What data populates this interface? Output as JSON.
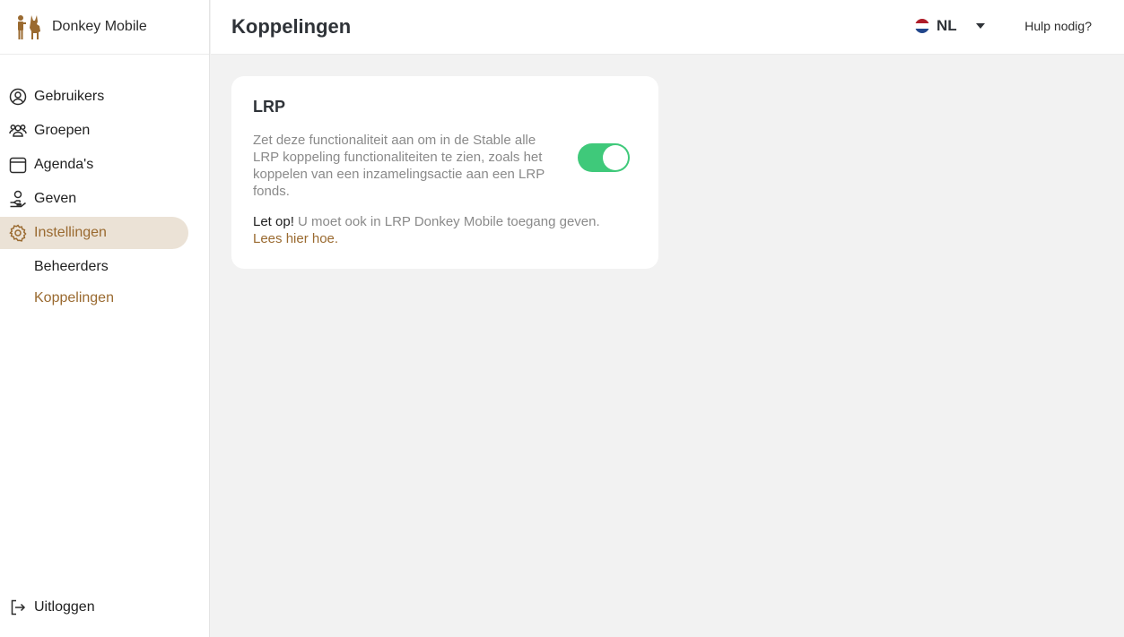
{
  "brand": {
    "name": "Donkey Mobile",
    "logo_icon": "donkey-logo-icon",
    "accent": "#9a6a30"
  },
  "sidebar": {
    "items": [
      {
        "label": "Gebruikers",
        "icon": "user-circle-icon"
      },
      {
        "label": "Groepen",
        "icon": "group-icon"
      },
      {
        "label": "Agenda's",
        "icon": "calendar-icon"
      },
      {
        "label": "Geven",
        "icon": "giving-hand-icon"
      },
      {
        "label": "Instellingen",
        "icon": "gear-icon",
        "active": true
      }
    ],
    "subitems": [
      {
        "label": "Beheerders"
      },
      {
        "label": "Koppelingen",
        "active": true
      }
    ],
    "logout": {
      "label": "Uitloggen",
      "icon": "logout-icon"
    }
  },
  "header": {
    "title": "Koppelingen",
    "language": {
      "code": "NL",
      "icon": "netherlands-flag-icon"
    },
    "help_label": "Hulp nodig?"
  },
  "card": {
    "title": "LRP",
    "description": "Zet deze functionaliteit aan om in de Stable alle LRP koppeling functionaliteiten te zien, zoals het koppelen van een inzamelingsactie aan een LRP fonds.",
    "toggle_on": true,
    "toggle_color": "#3fc97a",
    "notice_strong": "Let op!",
    "notice_text": " U moet ook in LRP Donkey Mobile toegang geven.",
    "notice_link": "Lees hier hoe."
  }
}
